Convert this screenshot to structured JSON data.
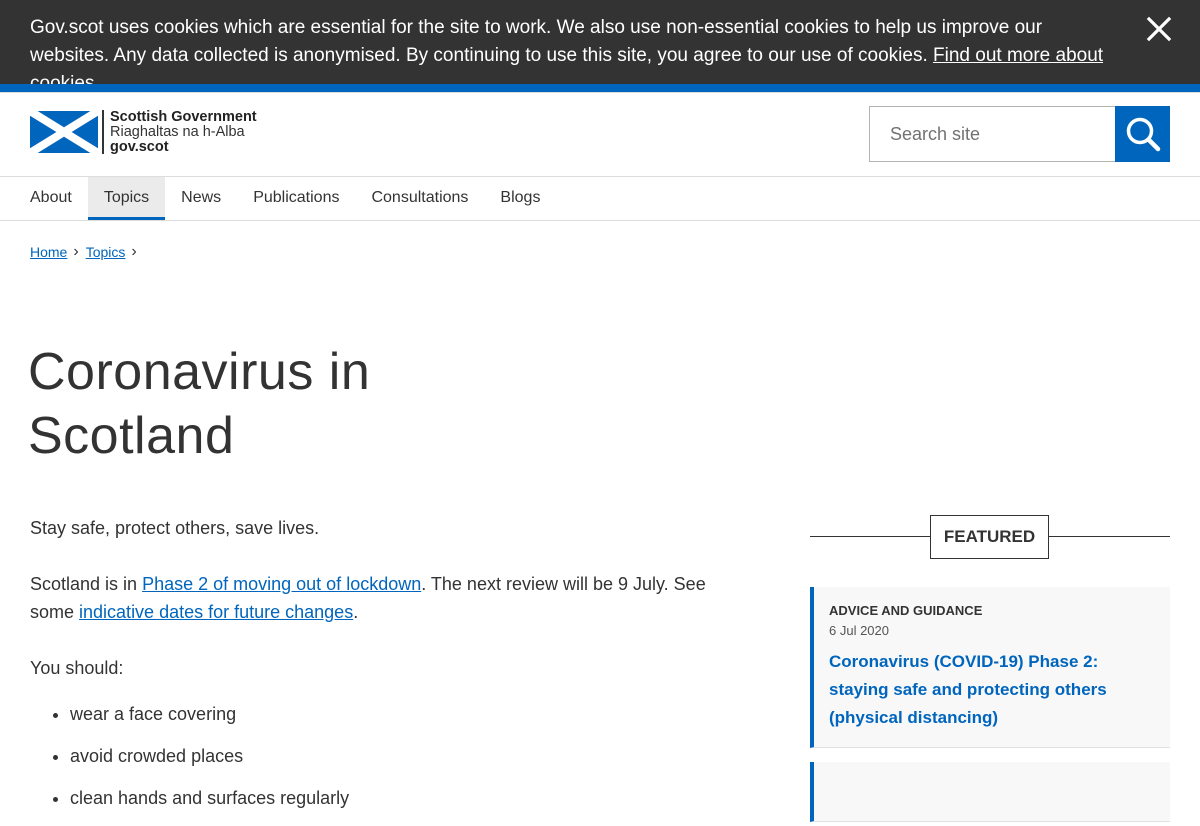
{
  "cookie_banner": {
    "text": "Gov.scot uses cookies which are essential for the site to work. We also use non-essential cookies to help us improve our websites. Any data collected is anonymised. By continuing to use this site, you agree to our use of cookies. ",
    "link_text": "Find out more about cookies",
    "close_icon": "close-icon"
  },
  "header": {
    "logo": {
      "line1": "Scottish Government",
      "line2": "Riaghaltas na h-Alba",
      "line3": "gov.scot",
      "flag_icon": "saltire-flag-icon"
    },
    "search": {
      "placeholder": "Search site",
      "button_icon": "search-icon"
    }
  },
  "nav": {
    "items": [
      {
        "label": "About"
      },
      {
        "label": "Topics",
        "active": true
      },
      {
        "label": "News"
      },
      {
        "label": "Publications"
      },
      {
        "label": "Consultations"
      },
      {
        "label": "Blogs"
      }
    ]
  },
  "breadcrumb": {
    "items": [
      {
        "label": "Home"
      },
      {
        "label": "Topics"
      }
    ]
  },
  "page_title": "Coronavirus in Scotland",
  "main": {
    "intro": "Stay safe, protect others, save lives.",
    "status_prefix": "Scotland is in ",
    "status_link": "Phase 2 of moving out of lockdown",
    "status_middle": ". The next review will be 9 July. See some ",
    "status_link2": "indicative dates for future changes",
    "status_suffix": ".",
    "you_should": "You should:",
    "list": [
      "wear a face covering",
      "avoid crowded places",
      "clean hands and surfaces regularly"
    ]
  },
  "featured": {
    "heading": "FEATURED",
    "cards": [
      {
        "type": "Advice and guidance",
        "date": "6 Jul 2020",
        "title": "Coronavirus (COVID-19) Phase 2: staying safe and protecting others (physical distancing)"
      }
    ]
  },
  "colors": {
    "brand_blue": "#0065bd",
    "cookie_bg": "#333333",
    "text": "#333333"
  }
}
